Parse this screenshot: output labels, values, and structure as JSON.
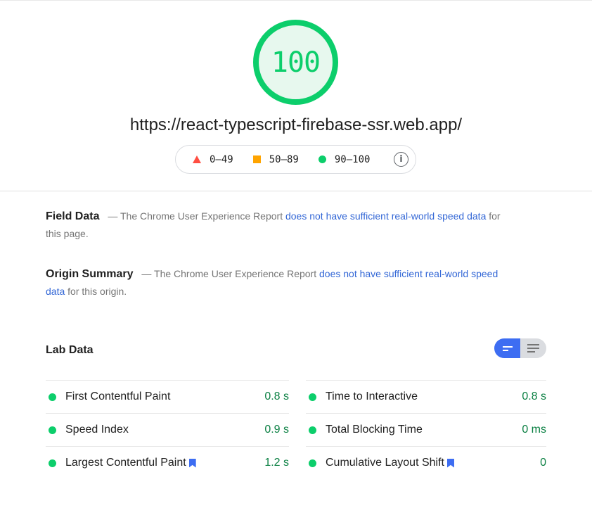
{
  "score": {
    "value": "100",
    "color": "#0cce6b"
  },
  "url": "https://react-typescript-firebase-ssr.web.app/",
  "legend": [
    {
      "icon": "triangle-fail-icon",
      "label": "0–49",
      "color": "#ff4e42"
    },
    {
      "icon": "square-average-icon",
      "label": "50–89",
      "color": "#ffa400"
    },
    {
      "icon": "circle-pass-icon",
      "label": "90–100",
      "color": "#0cce6b"
    }
  ],
  "field_data": {
    "heading": "Field Data",
    "prefix": "— The Chrome User Experience Report ",
    "link": "does not have sufficient real-world speed data",
    "suffix": " for this page."
  },
  "origin_summary": {
    "heading": "Origin Summary",
    "prefix": "— The Chrome User Experience Report ",
    "link": "does not have sufficient real-world speed data",
    "suffix": " for this origin."
  },
  "lab_data": {
    "title": "Lab Data",
    "left": [
      {
        "label": "First Contentful Paint",
        "value": "0.8 s",
        "bookmark": false
      },
      {
        "label": "Speed Index",
        "value": "0.9 s",
        "bookmark": false
      },
      {
        "label": "Largest Contentful Paint",
        "value": "1.2 s",
        "bookmark": true
      }
    ],
    "right": [
      {
        "label": "Time to Interactive",
        "value": "0.8 s",
        "bookmark": false
      },
      {
        "label": "Total Blocking Time",
        "value": "0 ms",
        "bookmark": false
      },
      {
        "label": "Cumulative Layout Shift",
        "value": "0",
        "bookmark": true
      }
    ]
  },
  "colors": {
    "pass": "#0cce6b",
    "pass_text": "#0b8043",
    "link": "#3367d6",
    "toggle_active": "#3d6df2"
  }
}
